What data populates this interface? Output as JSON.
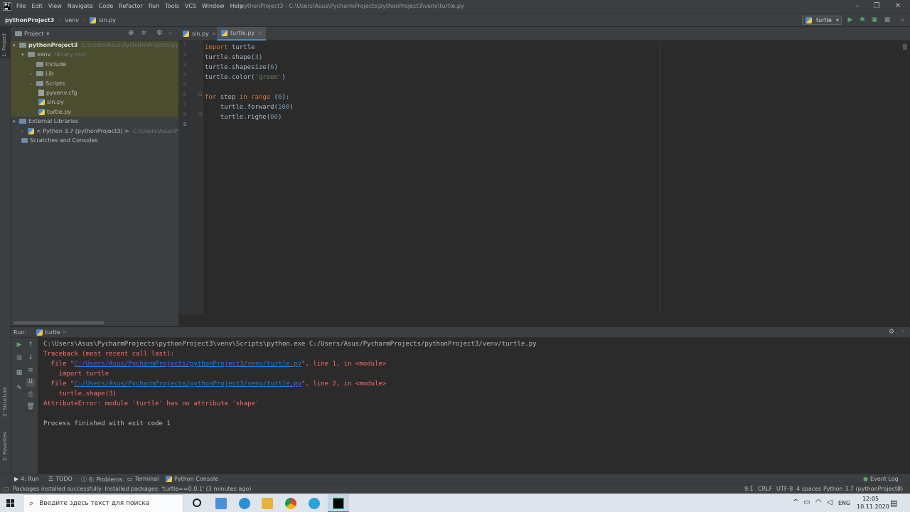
{
  "window": {
    "title": "pythonProject3 - C:\\Users\\Asus\\PycharmProjects\\pythonProject3\\venv\\turtle.py",
    "menu": [
      "File",
      "Edit",
      "View",
      "Navigate",
      "Code",
      "Refactor",
      "Run",
      "Tools",
      "VCS",
      "Window",
      "Help"
    ]
  },
  "navbar": {
    "crumbs": [
      "pythonProject3",
      "venv",
      "sin.py"
    ],
    "run_config": "turtle"
  },
  "left_stripe": {
    "project": "1: Project",
    "structure": "2: Structure",
    "favorites": "2: Favorites"
  },
  "project": {
    "header": "Project",
    "tree": [
      {
        "label": "pythonProject3",
        "extra": "C:\\Users\\Asus\\PycharmProjects\\pythonPr"
      },
      {
        "label": "venv",
        "extra": "library root"
      },
      {
        "label": "Include",
        "extra": ""
      },
      {
        "label": "Lib",
        "extra": ""
      },
      {
        "label": "Scripts",
        "extra": ""
      },
      {
        "label": "pyvenv.cfg",
        "extra": ""
      },
      {
        "label": "sin.py",
        "extra": ""
      },
      {
        "label": "turtle.py",
        "extra": ""
      },
      {
        "label": "External Libraries",
        "extra": ""
      },
      {
        "label": "< Python 3.7 (pythonProject3) >",
        "extra": "C:\\Users\\Asus\\Pychar"
      },
      {
        "label": "Scratches and Consoles",
        "extra": ""
      }
    ]
  },
  "editor": {
    "tabs": [
      "sin.py",
      "turtle.py"
    ],
    "line_numbers": [
      "1",
      "2",
      "3",
      "4",
      "5",
      "6",
      "7",
      "8",
      "9"
    ],
    "code": [
      "import turtle",
      "turtle.shape(3)",
      "turtle.shapesize(6)",
      "turtle.color('green')",
      "",
      "for step in range (6):",
      "    turtle.forward(100)",
      "    turtle.righe(60)",
      ""
    ]
  },
  "run": {
    "label": "Run:",
    "tab": "turtle",
    "command": "C:\\Users\\Asus\\PycharmProjects\\pythonProject3\\venv\\Scripts\\python.exe C:/Users/Asus/PycharmProjects/pythonProject3/venv/turtle.py",
    "traceback_header": "Traceback (most recent call last):",
    "frame1_prefix": "  File \"",
    "frame1_path": "C:/Users/Asus/PycharmProjects/pythonProject3/venv/turtle.py",
    "frame1_suffix": "\", line 1, in <module>",
    "frame1_code": "    import turtle",
    "frame2_prefix": "  File \"",
    "frame2_path": "C:/Users/Asus/PycharmProjects/pythonProject3/venv/turtle.py",
    "frame2_suffix": "\", line 2, in <module>",
    "frame2_code": "    turtle.shape(3)",
    "error": "AttributeError: module 'turtle' has no attribute 'shape'",
    "exit": "Process finished with exit code 1"
  },
  "tool_tabs": [
    "4: Run",
    "TODO",
    "6: Problems",
    "Terminal",
    "Python Console"
  ],
  "event_log": "Event Log",
  "status": {
    "message": "Packages installed successfully: Installed packages: 'turtle==0.0.1' (3 minutes ago)",
    "position": "9:1",
    "line_sep": "CRLF",
    "encoding": "UTF-8",
    "indent": "4 spaces",
    "interpreter": "Python 3.7 (pythonProject3)"
  },
  "taskbar": {
    "search_placeholder": "Введите здесь текст для поиска",
    "lang": "ENG",
    "time": "12:05",
    "date": "10.11.2020"
  },
  "colors": {
    "keyword": "#cc7832",
    "number": "#6897bb",
    "string": "#6a8759",
    "error": "#ff6b68",
    "link": "#287bde"
  }
}
